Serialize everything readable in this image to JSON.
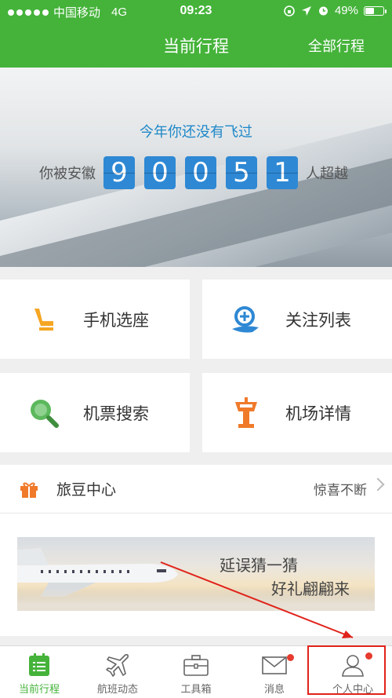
{
  "status_bar": {
    "carrier": "中国移动",
    "network": "4G",
    "time": "09:23",
    "battery": "49%",
    "battery_level": 0.49
  },
  "header": {
    "title": "当前行程",
    "all_trips": "全部行程"
  },
  "banner": {
    "message": "今年你还没有飞过",
    "prefix": "你被安徽",
    "digits": [
      "9",
      "0",
      "0",
      "5",
      "1"
    ],
    "suffix": "人超越"
  },
  "grid": [
    {
      "label": "手机选座",
      "icon": "seat-icon"
    },
    {
      "label": "关注列表",
      "icon": "follow-list-icon"
    },
    {
      "label": "机票搜索",
      "icon": "search-icon"
    },
    {
      "label": "机场详情",
      "icon": "airport-tower-icon"
    }
  ],
  "beans": {
    "title": "旅豆中心",
    "more": "惊喜不断"
  },
  "promo": {
    "line1": "延误猜一猜",
    "line2": "好礼翩翩来"
  },
  "tabs": [
    {
      "label": "当前行程",
      "icon": "calendar-list-icon"
    },
    {
      "label": "航班动态",
      "icon": "plane-icon"
    },
    {
      "label": "工具箱",
      "icon": "toolbox-icon"
    },
    {
      "label": "消息",
      "icon": "envelope-icon"
    },
    {
      "label": "个人中心",
      "icon": "person-icon"
    }
  ],
  "colors": {
    "brand_green": "#45b33a",
    "digit_blue": "#2e88d4",
    "accent_orange": "#f07a2a",
    "badge_red": "#e63b2e"
  }
}
